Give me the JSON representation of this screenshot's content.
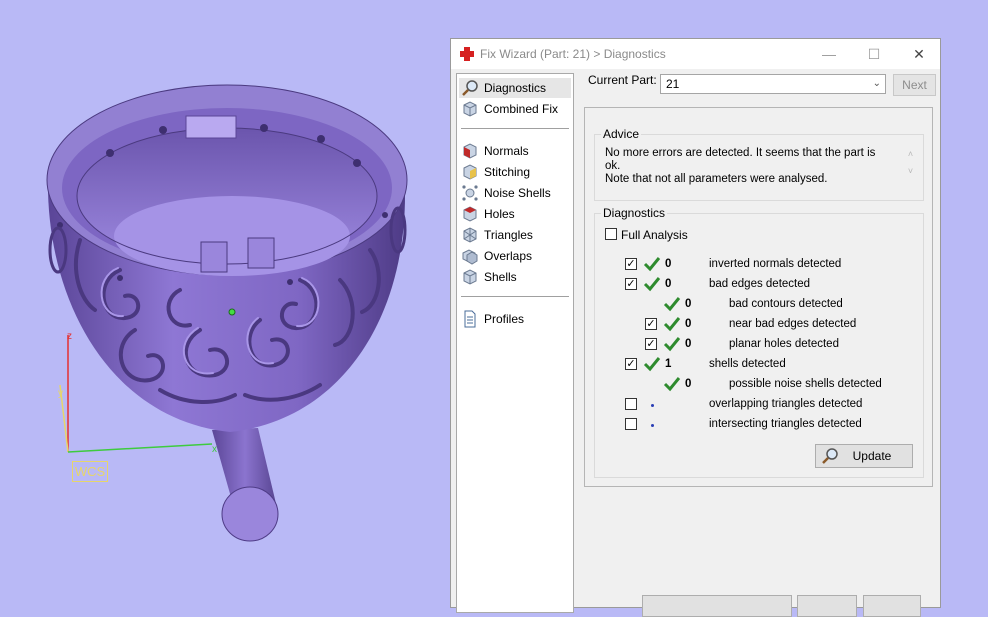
{
  "viewport": {
    "wcs_label": "WCS",
    "axis_z": "z",
    "axis_y": "y",
    "axis_x": "x"
  },
  "dialog": {
    "title": "Fix Wizard (Part: 21) > Diagnostics",
    "controls": {
      "minimize": "—",
      "maximize": "☐",
      "close": "✕"
    }
  },
  "nav": {
    "items": [
      {
        "label": "Diagnostics",
        "icon": "magnifier-icon",
        "selected": true
      },
      {
        "label": "Combined Fix",
        "icon": "cube-icon"
      },
      {
        "label": "Normals",
        "icon": "normals-cube-icon"
      },
      {
        "label": "Stitching",
        "icon": "stitching-cube-icon"
      },
      {
        "label": "Noise Shells",
        "icon": "noise-shells-icon"
      },
      {
        "label": "Holes",
        "icon": "holes-cube-icon"
      },
      {
        "label": "Triangles",
        "icon": "triangles-icon"
      },
      {
        "label": "Overlaps",
        "icon": "overlaps-icon"
      },
      {
        "label": "Shells",
        "icon": "shells-icon"
      },
      {
        "label": "Profiles",
        "icon": "document-icon"
      }
    ]
  },
  "current_part": {
    "label": "Current Part:",
    "value": "21"
  },
  "next_button": "Next",
  "advice": {
    "title": "Advice",
    "line1": "No more errors are detected. It seems that the part is ok.",
    "line2": "Note that not all parameters were analysed."
  },
  "diagnostics": {
    "title": "Diagnostics",
    "full_analysis": "Full Analysis",
    "rows": [
      {
        "label": "inverted normals detected",
        "count": "0",
        "checked": true,
        "status": "ok"
      },
      {
        "label": "bad edges detected",
        "count": "0",
        "checked": true,
        "status": "ok"
      },
      {
        "label": "bad contours detected",
        "count": "0",
        "checked": false,
        "status": "ok"
      },
      {
        "label": "near bad edges detected",
        "count": "0",
        "checked": true,
        "status": "ok"
      },
      {
        "label": "planar holes detected",
        "count": "0",
        "checked": true,
        "status": "ok"
      },
      {
        "label": "shells detected",
        "count": "1",
        "checked": true,
        "status": "ok"
      },
      {
        "label": "possible noise shells detected",
        "count": "0",
        "checked": false,
        "status": "ok"
      },
      {
        "label": "overlapping triangles detected",
        "count": "",
        "checked": false,
        "status": "pending"
      },
      {
        "label": "intersecting triangles detected",
        "count": "",
        "checked": false,
        "status": "pending"
      }
    ]
  },
  "update_button": "Update",
  "colors": {
    "viewport_bg": "#b9b9f6",
    "model": "#8a72cf",
    "check_green": "#2e8b2e",
    "wcs_yellow": "#e6d66a"
  }
}
